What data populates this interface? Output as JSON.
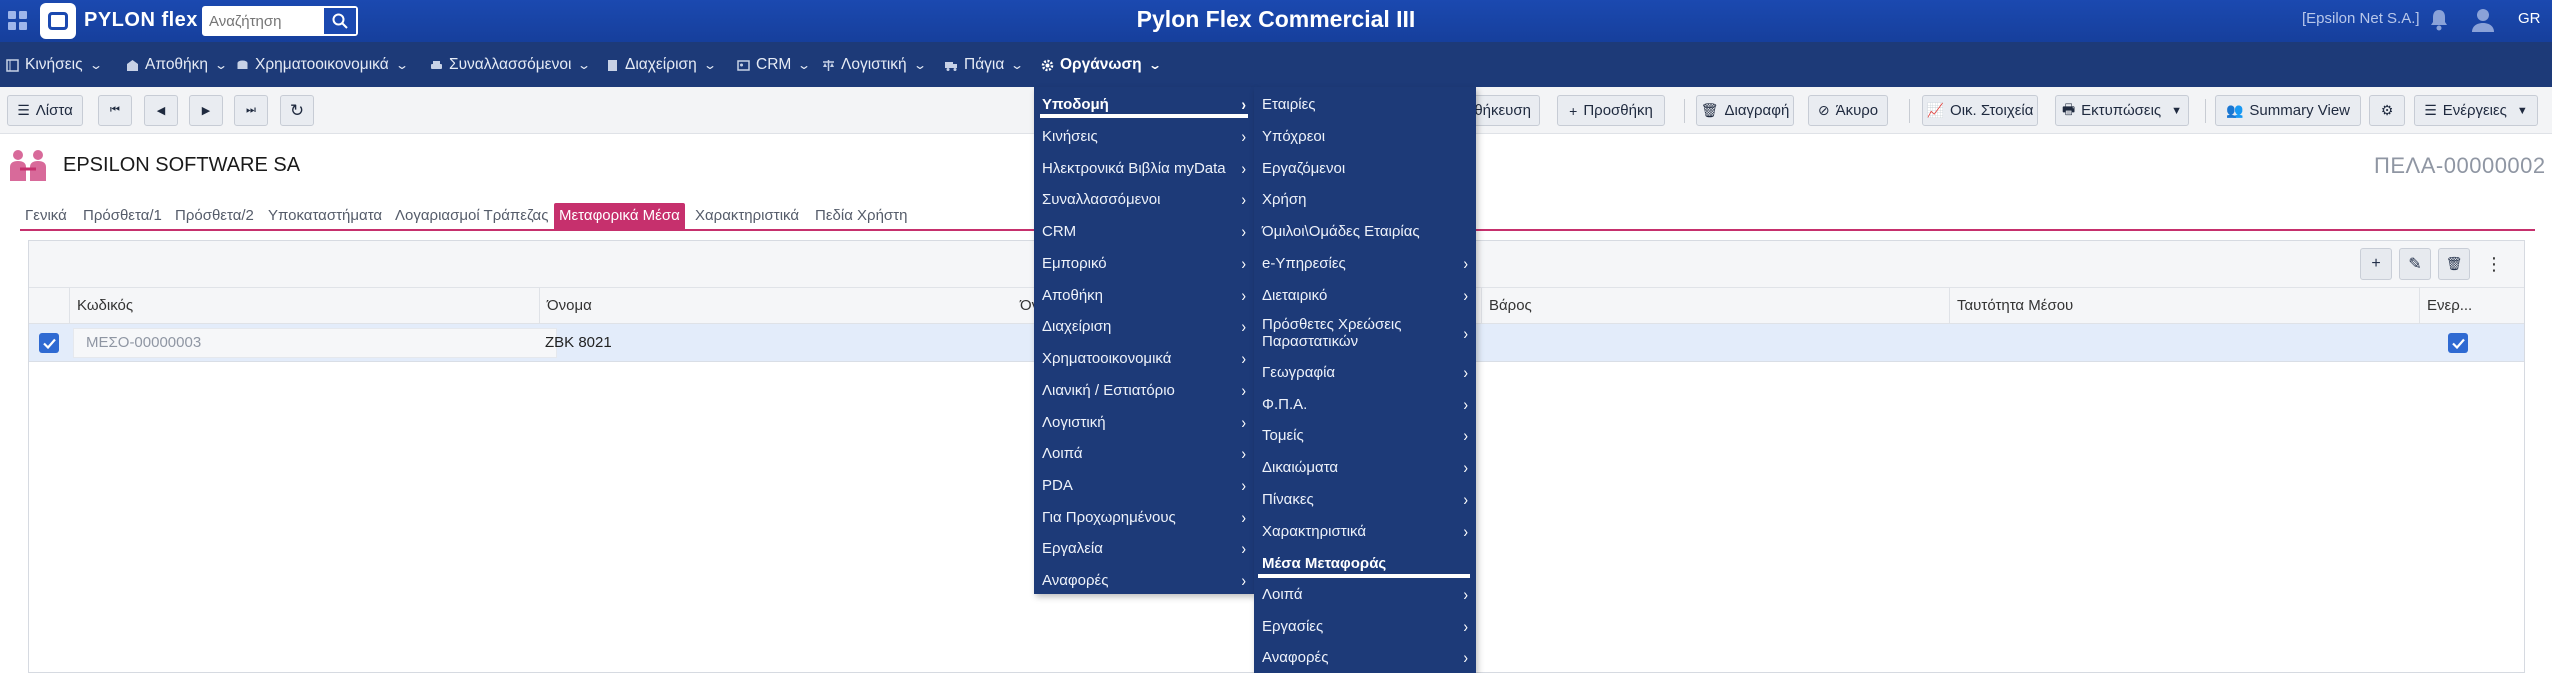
{
  "app": {
    "brand": "PYLON flex",
    "title": "Pylon Flex Commercial III",
    "company_tag": "[Epsilon Net S.A.]",
    "language": "GR",
    "search_placeholder": "Αναζήτηση"
  },
  "menubar": [
    {
      "label": "Κινήσεις",
      "icon": "ledger-icon"
    },
    {
      "label": "Αποθήκη",
      "icon": "warehouse-icon"
    },
    {
      "label": "Χρηματοοικονομικά",
      "icon": "coins-icon"
    },
    {
      "label": "Συναλλασσόμενοι",
      "icon": "car-icon"
    },
    {
      "label": "Διαχείριση",
      "icon": "document-icon"
    },
    {
      "label": "CRM",
      "icon": "id-card-icon"
    },
    {
      "label": "Λογιστική",
      "icon": "balance-icon"
    },
    {
      "label": "Πάγια",
      "icon": "truck-icon"
    },
    {
      "label": "Οργάνωση",
      "icon": "gear-icon"
    }
  ],
  "toolbar": {
    "list": "Λίστα",
    "save_partial": "θήκευση",
    "add": "Προσθήκη",
    "delete": "Διαγραφή",
    "cancel": "Άκυρο",
    "financial": "Οικ. Στοιχεία",
    "prints": "Εκτυπώσεις",
    "summary": "Summary View",
    "actions": "Ενέργειες"
  },
  "record": {
    "company_name": "EPSILON SOFTWARE SA",
    "doc_code": "ΠΕΛΑ-00000002"
  },
  "tabs": [
    "Γενικά",
    "Πρόσθετα/1",
    "Πρόσθετα/2",
    "Υποκαταστήματα",
    "Λογαριασμοί Τράπεζας",
    "Μεταφορικά Μέσα",
    "Χαρακτηριστικά",
    "Πεδία Χρήστη"
  ],
  "grid": {
    "columns": [
      "Κωδικός",
      "Όνομα",
      "Όγ",
      "Βάρος",
      "Ταυτότητα Μέσου",
      "Ενερ..."
    ],
    "rows": [
      {
        "code": "ΜΕΣΟ-00000003",
        "name": "ZBK 8021",
        "volume": "",
        "weight": "",
        "identity": "",
        "active": true
      }
    ]
  },
  "menu_level1": [
    "Υποδομή",
    "Κινήσεις",
    "Ηλεκτρονικά Βιβλία myData",
    "Συναλλασσόμενοι",
    "CRM",
    "Εμπορικό",
    "Αποθήκη",
    "Διαχείριση",
    "Χρηματοοικονομικά",
    "Λιανική / Εστιατόριο",
    "Λογιστική",
    "Λοιπά",
    "PDA",
    "Για Προχωρημένους",
    "Εργαλεία",
    "Αναφορές"
  ],
  "menu_level2": [
    {
      "label": "Εταιρίες",
      "sub": false
    },
    {
      "label": "Υπόχρεοι",
      "sub": false
    },
    {
      "label": "Εργαζόμενοι",
      "sub": false
    },
    {
      "label": "Χρήση",
      "sub": false
    },
    {
      "label": "Όμιλοι\\Ομάδες Εταιρίας",
      "sub": false
    },
    {
      "label": "e-Υπηρεσίες",
      "sub": true
    },
    {
      "label": "Διεταιρικό",
      "sub": true
    },
    {
      "label": "Πρόσθετες Χρεώσεις Παραστατικών",
      "sub": true
    },
    {
      "label": "Γεωγραφία",
      "sub": true
    },
    {
      "label": "Φ.Π.Α.",
      "sub": true
    },
    {
      "label": "Τομείς",
      "sub": true
    },
    {
      "label": "Δικαιώματα",
      "sub": true
    },
    {
      "label": "Πίνακες",
      "sub": true
    },
    {
      "label": "Χαρακτηριστικά",
      "sub": true
    },
    {
      "label": "Μέσα Μεταφοράς",
      "sub": false
    },
    {
      "label": "Λοιπά",
      "sub": true
    },
    {
      "label": "Εργασίες",
      "sub": true
    },
    {
      "label": "Αναφορές",
      "sub": true
    }
  ],
  "colors": {
    "topbar": "#1b49b0",
    "menubar": "#1d3a78",
    "accent_tab": "#c6306d",
    "checkbox": "#2f6ad2"
  }
}
